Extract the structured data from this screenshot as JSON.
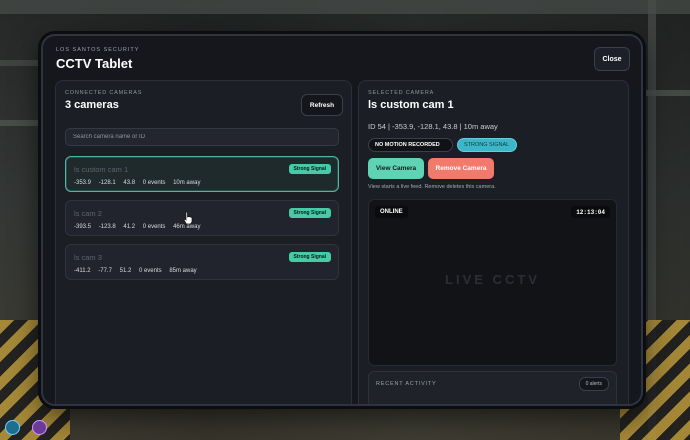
{
  "header": {
    "subtitle": "LOS SANTOS SECURITY",
    "title": "CCTV Tablet",
    "close_label": "Close"
  },
  "left_panel": {
    "label": "CONNECTED CAMERAS",
    "count_title": "3 cameras",
    "refresh_label": "Refresh",
    "search_placeholder": "Search camera name or ID",
    "cameras": [
      {
        "name": "ls custom cam 1",
        "signal": "Strong Signal",
        "x": "-353.9",
        "y": "-128.1",
        "z": "43.8",
        "events": "0 events",
        "distance": "10m away",
        "selected": true
      },
      {
        "name": "ls cam 2",
        "signal": "Strong Signal",
        "x": "-393.5",
        "y": "-123.8",
        "z": "41.2",
        "events": "0 events",
        "distance": "46m away",
        "selected": false
      },
      {
        "name": "ls cam 3",
        "signal": "Strong Signal",
        "x": "-411.2",
        "y": "-77.7",
        "z": "51.2",
        "events": "0 events",
        "distance": "85m away",
        "selected": false
      }
    ]
  },
  "right_panel": {
    "label": "SELECTED CAMERA",
    "title": "ls custom cam 1",
    "info": "ID 54 | -353.9, -128.1, 43.8 | 10m away",
    "motion_pill": "NO MOTION RECORDED",
    "signal_pill": "STRONG SIGNAL",
    "view_label": "View Camera",
    "remove_label": "Remove Camera",
    "hint": "View starts a live feed. Remove deletes this camera.",
    "feed": {
      "status": "ONLINE",
      "time": "12:13:04",
      "watermark": "LIVE CCTV"
    },
    "activity": {
      "label": "RECENT ACTIVITY",
      "alerts": "0 alerts"
    }
  },
  "colors": {
    "accent_teal": "#5fd3b4",
    "danger": "#f27a6d",
    "panel_bg": "#1b1e25"
  }
}
